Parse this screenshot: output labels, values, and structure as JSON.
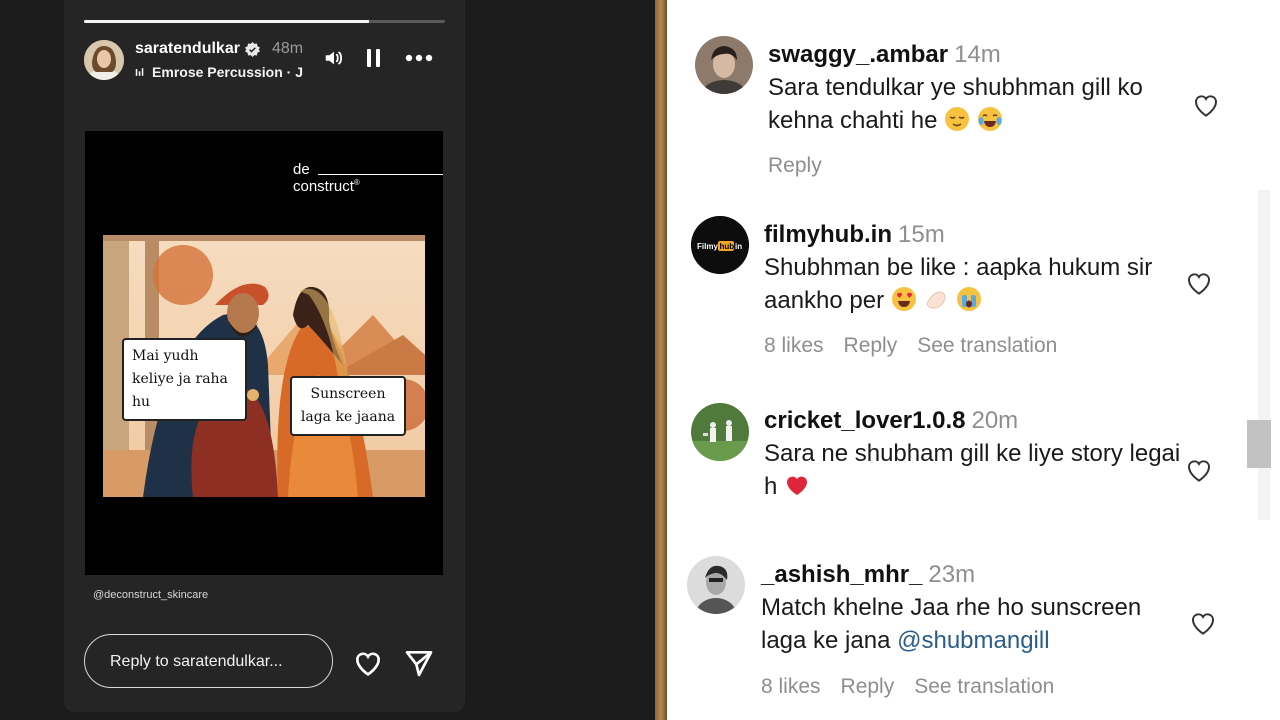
{
  "story": {
    "username": "saratendulkar",
    "time": "48m",
    "music": "Emrose Percussion · J",
    "progress": 0.79,
    "brand_line1": "de",
    "brand_line2": "construct",
    "brand_mark": "®",
    "bubble1": "Mai yudh keliye ja raha hu",
    "bubble2": "Sunscreen laga ke jaana",
    "credit": "@deconstruct_skincare",
    "reply_placeholder": "Reply to saratendulkar..."
  },
  "comments": [
    {
      "username": "swaggy_.ambar",
      "time": "14m",
      "text": "Sara tendulkar ye shubhman gill ko kehna chahti he",
      "emojis": [
        "relieved-face-emoji",
        "tears-of-joy-emoji"
      ],
      "meta": [
        "Reply"
      ]
    },
    {
      "username": "filmyhub.in",
      "time": "15m",
      "avatar_logo": "Filmy hub in",
      "text": "Shubhman be like : aapka hukum sir aankho per",
      "emojis": [
        "heart-eyes-emoji",
        "hand-emoji",
        "crying-emoji"
      ],
      "meta": [
        "8 likes",
        "Reply",
        "See translation"
      ]
    },
    {
      "username": "cricket_lover1.0.8",
      "time": "20m",
      "text": "Sara ne shubham gill ke liye story legai h",
      "emojis": [
        "red-heart-emoji"
      ],
      "meta": []
    },
    {
      "username": "_ashish_mhr_",
      "time": "23m",
      "text": "Match khelne Jaa rhe ho sunscreen laga ke jana",
      "mention": "@shubmangill",
      "meta": [
        "8 likes",
        "Reply",
        "See translation"
      ]
    }
  ],
  "colors": {
    "story_bg": "#252525",
    "page_bg": "#1b1b1b",
    "mention": "#2b5d8a",
    "meta_gray": "#8e8e8e"
  }
}
